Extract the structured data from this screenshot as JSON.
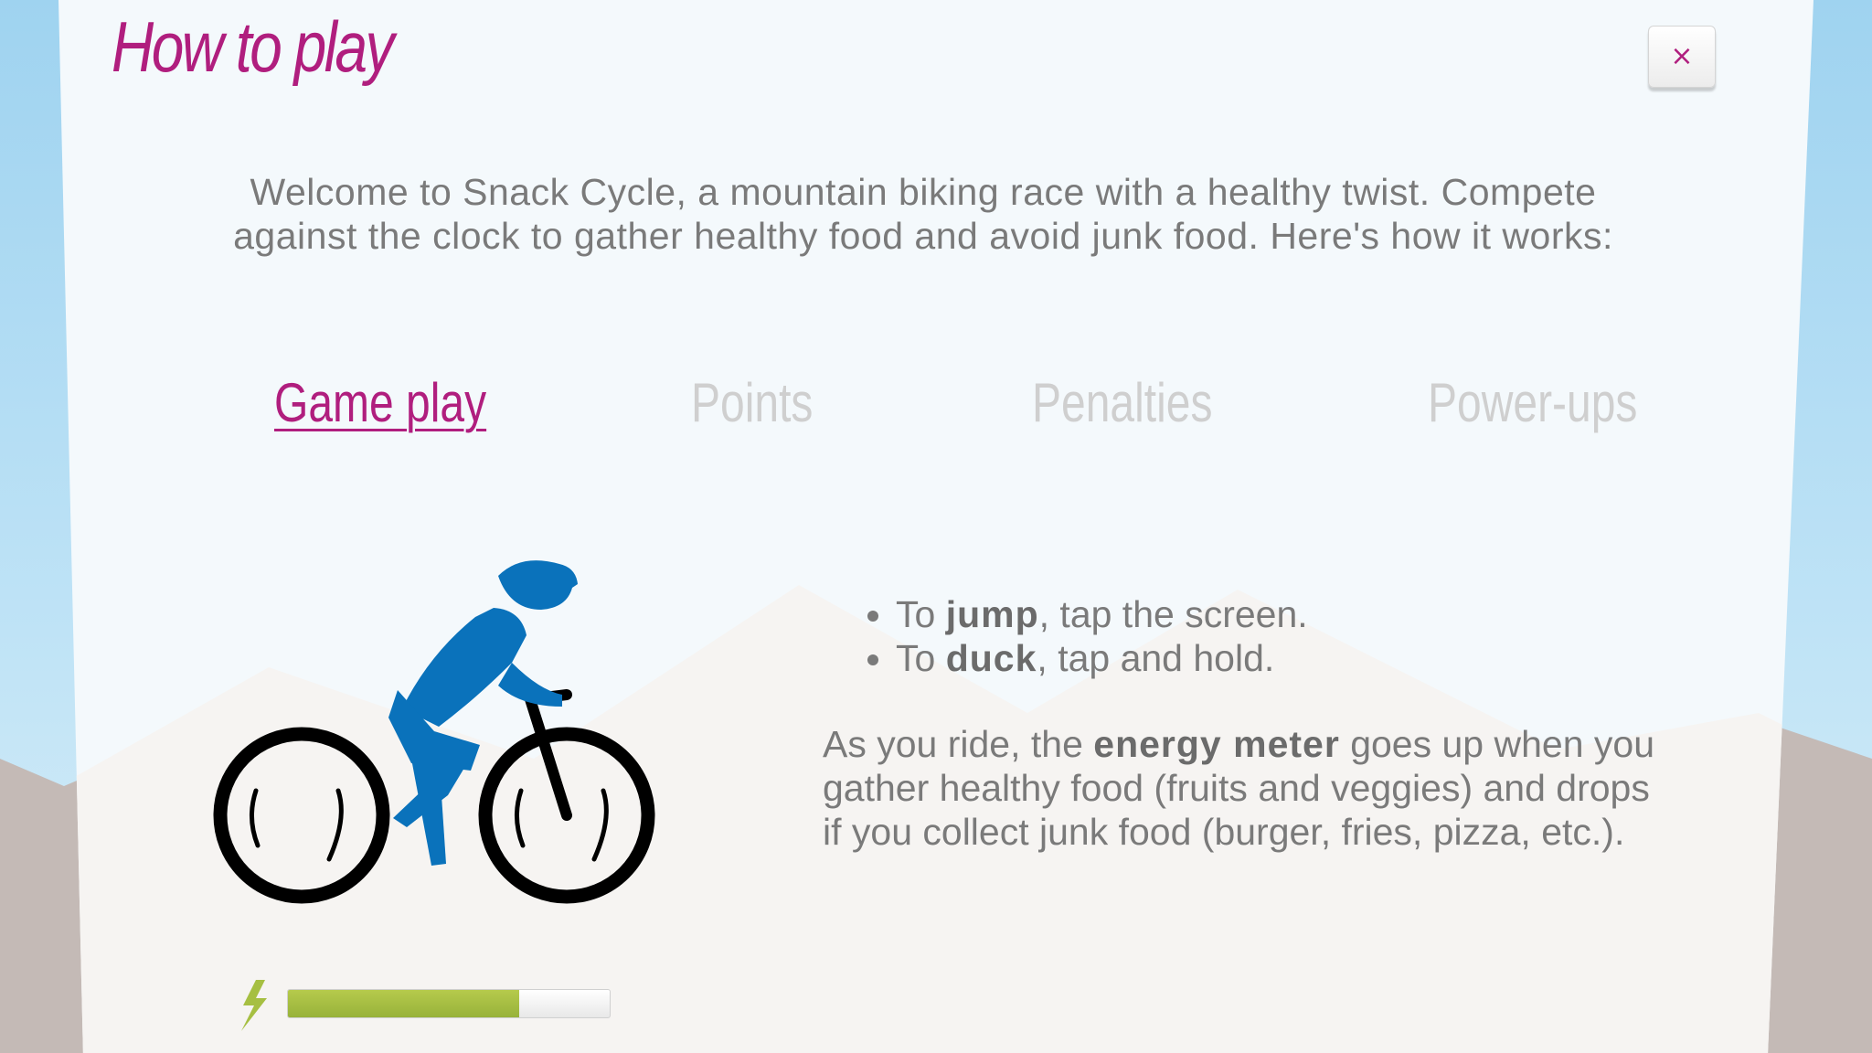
{
  "title": "How to play",
  "close_label": "×",
  "intro": "Welcome to Snack Cycle, a mountain biking race with a healthy twist. Compete against the clock to gather healthy food and avoid junk food. Here's how it works:",
  "tabs": [
    {
      "label": "Game play",
      "active": true
    },
    {
      "label": "Points",
      "active": false
    },
    {
      "label": "Penalties",
      "active": false
    },
    {
      "label": "Power-ups",
      "active": false
    }
  ],
  "instructions": [
    {
      "before": "To ",
      "bold": "jump",
      "after": ", tap the screen."
    },
    {
      "before": "To ",
      "bold": "duck",
      "after": ", tap and hold."
    }
  ],
  "paragraph": {
    "before": "As you ride, the ",
    "bold": "energy meter",
    "after": " goes up when you gather healthy food (fruits and veggies) and drops if you collect junk food (burger, fries, pizza, etc.)."
  },
  "energy_meter": {
    "fill": 0.72
  },
  "colors": {
    "accent": "#b01e7e",
    "rider": "#0a72bb",
    "energy": "#a6bf42",
    "text": "#7a7a7a",
    "inactive_tab": "#cfcfcf"
  },
  "icons": {
    "close": "close-icon",
    "rider": "cyclist-icon",
    "energy": "lightning-bolt-icon"
  }
}
